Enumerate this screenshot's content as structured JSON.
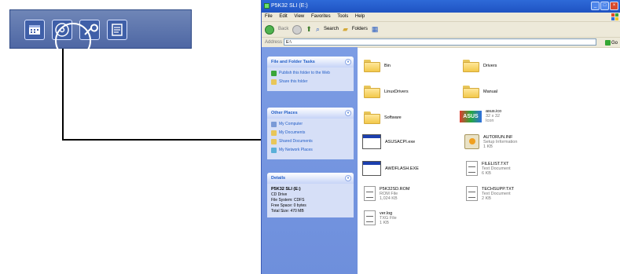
{
  "callout": {
    "icons": [
      "calendar-icon",
      "disc-icon",
      "wrench-icon",
      "document-icon"
    ]
  },
  "window": {
    "title": "P5K32 SLI (E:)",
    "menu": [
      "File",
      "Edit",
      "View",
      "Favorites",
      "Tools",
      "Help"
    ],
    "toolbar": {
      "back": "Back",
      "search": "Search",
      "folders": "Folders"
    },
    "address_label": "Address",
    "address_value": "E:\\",
    "go_label": "Go"
  },
  "file_folder_tasks": {
    "title": "File and Folder Tasks",
    "items": [
      "Publish this folder to the Web",
      "Share this folder"
    ]
  },
  "other_places": {
    "title": "Other Places",
    "items": [
      "My Computer",
      "My Documents",
      "Shared Documents",
      "My Network Places"
    ]
  },
  "details": {
    "title": "Details",
    "name": "P5K32 SLI (E:)",
    "type": "CD Drive",
    "file_system": "File System: CDFS",
    "free_space": "Free Space: 0 bytes",
    "total_size": "Total Size: 470 MB"
  },
  "files": [
    {
      "name": "Bin",
      "icon": "folder-icon"
    },
    {
      "name": "Drivers",
      "icon": "folder-icon"
    },
    {
      "name": "LinuxDrivers",
      "icon": "folder-icon"
    },
    {
      "name": "Manual",
      "icon": "folder-icon"
    },
    {
      "name": "Software",
      "icon": "folder-icon"
    },
    {
      "name": "asus.ico",
      "line2": "32 x 32",
      "line3": "Icon",
      "icon": "asus-icon"
    },
    {
      "name": "ASUSACPI.exe",
      "icon": "exe-icon"
    },
    {
      "name": "AUTORUN.INF",
      "line2": "Setup Information",
      "line3": "1 KB",
      "icon": "setup-icon"
    },
    {
      "name": "AWDFLASH.EXE",
      "icon": "exe-icon"
    },
    {
      "name": "FILELIST.TXT",
      "line2": "Text Document",
      "line3": "6 KB",
      "icon": "text-doc-icon"
    },
    {
      "name": "P5K32SD.ROM",
      "line2": "ROM File",
      "line3": "1,024 KB",
      "icon": "rom-file-icon"
    },
    {
      "name": "TECHSUPP.TXT",
      "line2": "Text Document",
      "line3": "2 KB",
      "icon": "text-doc-icon"
    },
    {
      "name": "ver.log",
      "line2": "TXG File",
      "line3": "1 KB",
      "icon": "log-file-icon"
    }
  ]
}
